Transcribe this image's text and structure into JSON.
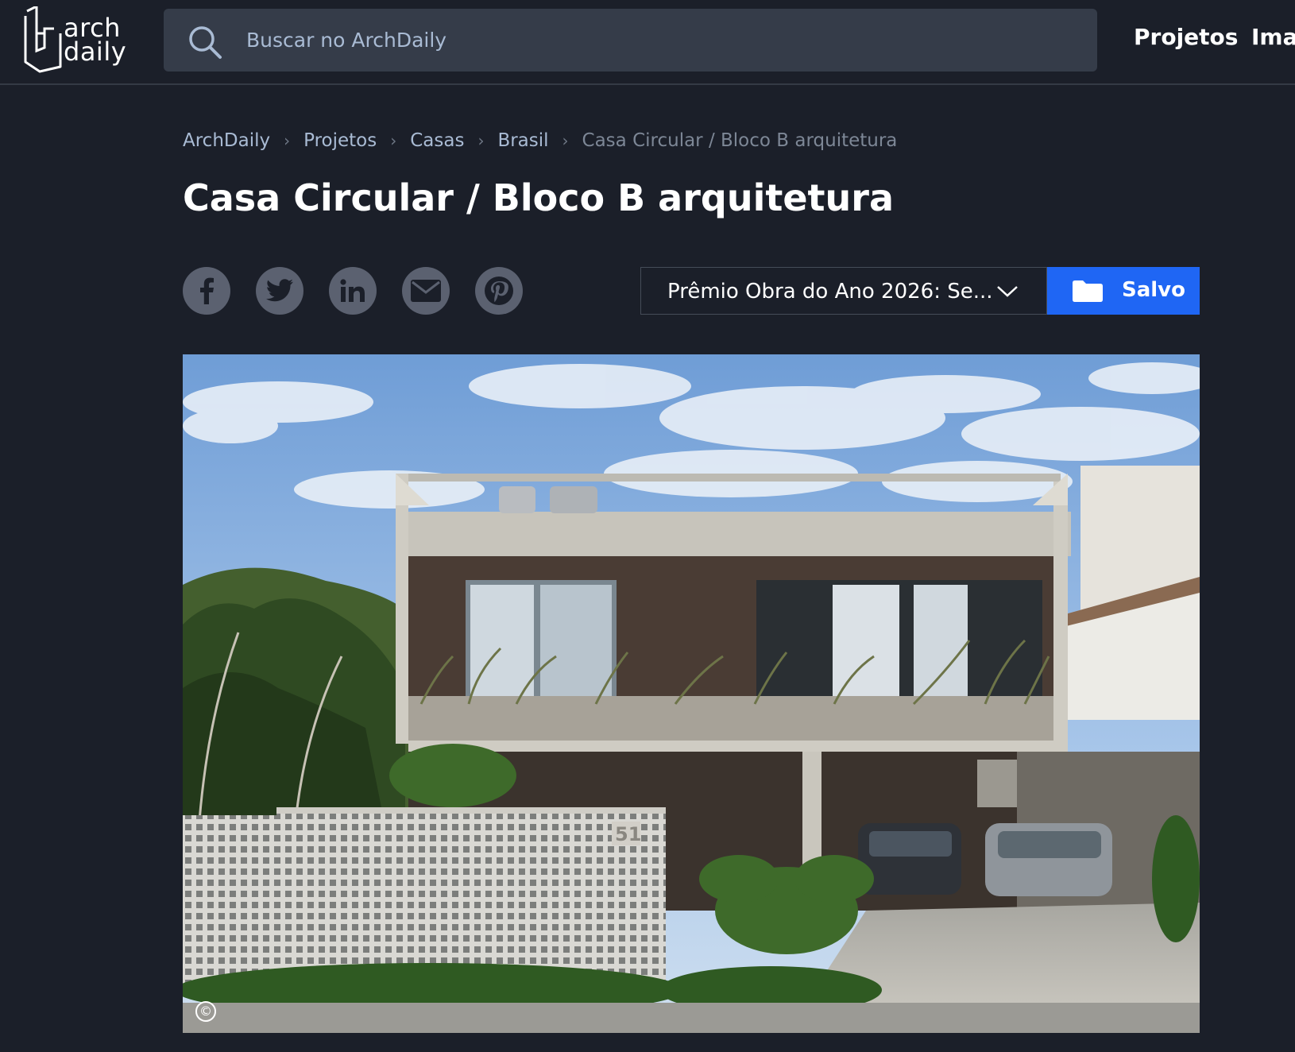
{
  "header": {
    "logo_text_top": "arch",
    "logo_text_bottom": "daily",
    "search_placeholder": "Buscar no ArchDaily",
    "nav": [
      {
        "label": "Projetos"
      },
      {
        "label": "Ima"
      }
    ]
  },
  "breadcrumb": {
    "items": [
      "ArchDaily",
      "Projetos",
      "Casas",
      "Brasil"
    ],
    "current": "Casa Circular / Bloco B arquitetura"
  },
  "page": {
    "title": "Casa Circular / Bloco B arquitetura"
  },
  "share": {
    "icons": [
      "facebook-icon",
      "twitter-icon",
      "linkedin-icon",
      "email-icon",
      "pinterest-icon"
    ]
  },
  "collection": {
    "selected": "Prêmio Obra do Ano 2026: Se..."
  },
  "save": {
    "label": "Salvo",
    "color": "#1f66f4"
  },
  "photo": {
    "copyright_symbol": "©",
    "house_number": "51"
  },
  "colors": {
    "background": "#1b1f29",
    "search_bg": "#353c49",
    "link": "#a9bbd4",
    "accent": "#1f66f4"
  }
}
